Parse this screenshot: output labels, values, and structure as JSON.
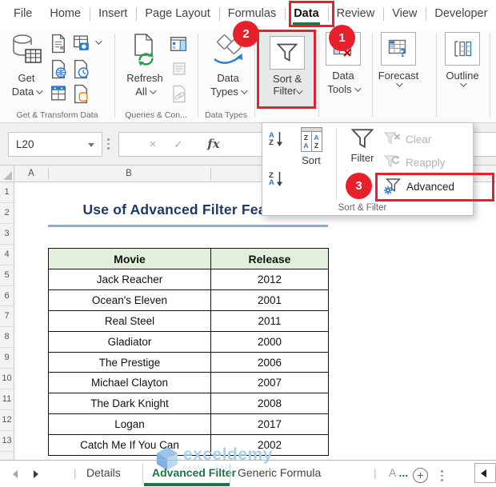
{
  "menubar": {
    "items": [
      {
        "label": "File",
        "active": false
      },
      {
        "label": "Home",
        "active": false
      },
      {
        "label": "Insert",
        "active": false
      },
      {
        "label": "Page Layout",
        "active": false
      },
      {
        "label": "Formulas",
        "active": false
      },
      {
        "label": "Data",
        "active": true
      },
      {
        "label": "Review",
        "active": false
      },
      {
        "label": "View",
        "active": false
      },
      {
        "label": "Developer",
        "active": false
      }
    ]
  },
  "ribbon": {
    "groups": [
      {
        "label": "Get & Transform Data"
      },
      {
        "label": "Queries & Con..."
      },
      {
        "label": "Data Types"
      }
    ],
    "buttons": {
      "get_data": {
        "line1": "Get",
        "line2": "Data"
      },
      "refresh_all": {
        "line1": "Refresh",
        "line2": "All"
      },
      "data_types": {
        "line1": "Data",
        "line2": "Types"
      },
      "sort_filter": {
        "line1": "Sort &",
        "line2": "Filter"
      },
      "data_tools": {
        "line1": "Data",
        "line2": "Tools"
      },
      "forecast": {
        "line1": "Forecast"
      },
      "outline": {
        "line1": "Outline"
      }
    }
  },
  "formula_bar": {
    "name_box": "L20",
    "cancel_glyph": "×",
    "enter_glyph": "✓",
    "fx_label": "fx"
  },
  "sort_filter_menu": {
    "sort_label": "Sort",
    "filter_label": "Filter",
    "clear_label": "Clear",
    "reapply_label": "Reapply",
    "advanced_label": "Advanced",
    "group_label": "Sort & Filter",
    "sort_icon_letters": {
      "a": "A",
      "z": "Z"
    }
  },
  "annotations": {
    "step1": "1",
    "step2": "2",
    "step3": "3"
  },
  "worksheet": {
    "title": "Use of Advanced Filter Feature",
    "column_headers": [
      "A",
      "B"
    ],
    "row_numbers": [
      "1",
      "2",
      "3",
      "4",
      "5",
      "6",
      "7",
      "8",
      "9",
      "10",
      "11",
      "12",
      "13"
    ],
    "table": {
      "headers": [
        "Movie",
        "Release"
      ],
      "rows": [
        [
          "Jack Reacher",
          "2012"
        ],
        [
          "Ocean's Eleven",
          "2001"
        ],
        [
          "Real Steel",
          "2011"
        ],
        [
          "Gladiator",
          "2000"
        ],
        [
          "The Prestige",
          "2006"
        ],
        [
          "Michael Clayton",
          "2007"
        ],
        [
          "The Dark Knight",
          "2008"
        ],
        [
          "Logan",
          "2017"
        ],
        [
          "Catch Me If You Can",
          "2002"
        ]
      ]
    }
  },
  "sheet_tabs": {
    "items": [
      {
        "label": "Details",
        "active": false
      },
      {
        "label": "Advanced Filter",
        "active": true
      },
      {
        "label": "Generic Formula",
        "active": false
      }
    ],
    "partial": {
      "prefix": "A",
      "dots": "..."
    }
  },
  "watermark": {
    "brand": "exceldemy",
    "caption": "EXCEL - DATA"
  },
  "colors": {
    "annotation_red": "#E8202C",
    "excel_green": "#217346",
    "table_header_fill": "#E2EFDA",
    "title_color": "#1F3864",
    "title_underline": "#8FAADC"
  }
}
